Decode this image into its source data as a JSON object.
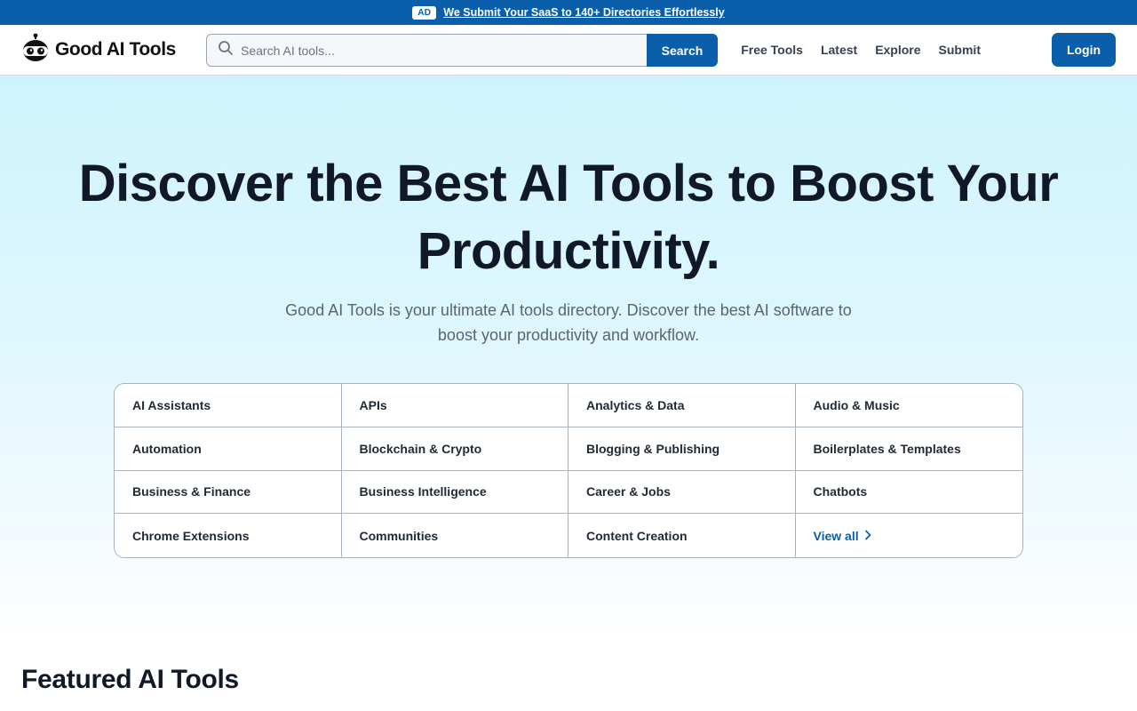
{
  "ad_bar": {
    "badge": "AD",
    "text": "We Submit Your SaaS to 140+ Directories Effortlessly"
  },
  "header": {
    "logo_text": "Good AI Tools",
    "search": {
      "placeholder": "Search AI tools...",
      "value": "",
      "button_label": "Search"
    },
    "nav": [
      "Free Tools",
      "Latest",
      "Explore",
      "Submit"
    ],
    "login_label": "Login"
  },
  "hero": {
    "title": "Discover the Best AI Tools to Boost Your Productivity.",
    "subtitle": "Good AI Tools is your ultimate AI tools directory. Discover the best AI software to boost your productivity and workflow."
  },
  "categories": [
    "AI Assistants",
    "APIs",
    "Analytics & Data",
    "Audio & Music",
    "Automation",
    "Blockchain & Crypto",
    "Blogging & Publishing",
    "Boilerplates & Templates",
    "Business & Finance",
    "Business Intelligence",
    "Career & Jobs",
    "Chatbots",
    "Chrome Extensions",
    "Communities",
    "Content Creation"
  ],
  "view_all_label": "View all",
  "featured_heading": "Featured AI Tools",
  "colors": {
    "brand": "#0a5eaa",
    "hero_top": "#cff3fd",
    "text_dark": "#111827"
  },
  "icons": {
    "logo": "robot-head-icon",
    "search": "search-icon",
    "view_all": "chevron-right-icon"
  }
}
